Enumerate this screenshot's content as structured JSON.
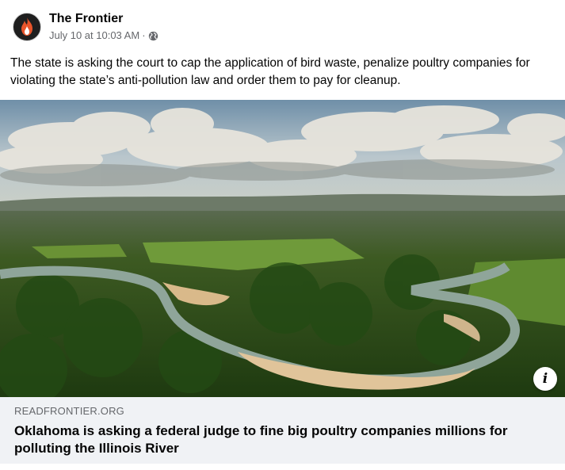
{
  "post": {
    "page_name": "The Frontier",
    "timestamp": "July 10 at 10:03 AM",
    "separator": "·",
    "audience_icon": "globe-icon",
    "caption": "The state is asking the court to cap the application of bird waste, penalize poultry companies for violating the state’s anti-pollution law and order them to pay for cleanup."
  },
  "link_preview": {
    "domain": "READFRONTIER.ORG",
    "title": "Oklahoma is asking a federal judge to fine big poultry companies millions for polluting the Illinois River",
    "info_icon": "i"
  },
  "colors": {
    "secondary_text": "#65676b",
    "link_box_bg": "#f0f2f5",
    "avatar_bg": "#1f1f1f",
    "avatar_flame": "#e8552b"
  }
}
